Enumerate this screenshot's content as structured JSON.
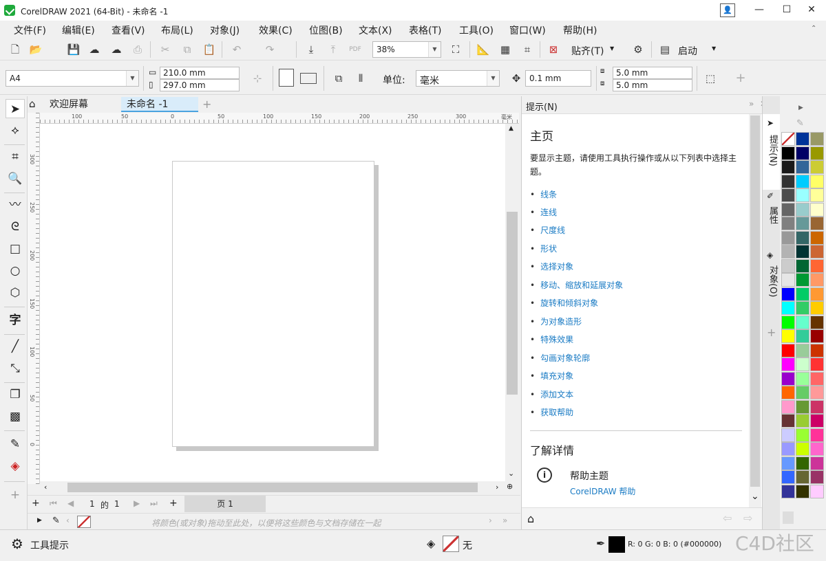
{
  "window": {
    "title": "CorelDRAW 2021 (64-Bit) - 未命名 -1"
  },
  "menu": [
    "文件(F)",
    "编辑(E)",
    "查看(V)",
    "布局(L)",
    "对象(J)",
    "效果(C)",
    "位图(B)",
    "文本(X)",
    "表格(T)",
    "工具(O)",
    "窗口(W)",
    "帮助(H)"
  ],
  "toolbar": {
    "zoom": "38%",
    "snap_label": "贴齐(T)",
    "launch_label": "启动"
  },
  "property_bar": {
    "page_size": "A4",
    "width": "210.0 mm",
    "height": "297.0 mm",
    "unit_label": "单位:",
    "unit_value": "毫米",
    "nudge": "0.1 mm",
    "dup_x": "5.0 mm",
    "dup_y": "5.0 mm"
  },
  "tabs": {
    "home": "欢迎屏幕",
    "doc": "未命名 -1"
  },
  "ruler_h": [
    "100",
    "50",
    "0",
    "50",
    "100",
    "150",
    "200",
    "250",
    "300",
    "毫米"
  ],
  "ruler_v": [
    "300",
    "250",
    "200",
    "150",
    "100",
    "50",
    "0"
  ],
  "pagenav": {
    "current": "1",
    "of": "的",
    "total": "1",
    "page_tab": "页 1"
  },
  "doc_palette": {
    "hint": "将颜色(或对象)拖动至此处，以便将这些颜色与文档存储在一起"
  },
  "hints": {
    "header": "提示(N)",
    "title": "主页",
    "desc": "要显示主题，请使用工具执行操作或从以下列表中选择主题。",
    "topics": [
      "线条",
      "连线",
      "尺度线",
      "形状",
      "选择对象",
      "移动、缩放和延展对象",
      "旋转和倾斜对象",
      "为对象造形",
      "特殊效果",
      "勾画对象轮廓",
      "填充对象",
      "添加文本",
      "获取帮助"
    ],
    "more_title": "了解详情",
    "help_topic": "帮助主题",
    "help_link": "CorelDRAW 帮助"
  },
  "side_tabs": [
    "提示(N)",
    "属性",
    "对象(O)"
  ],
  "palette": {
    "col1": [
      "#ffffff",
      "#000000",
      "#1a1a1a",
      "#333333",
      "#4d4d4d",
      "#666666",
      "#808080",
      "#999999",
      "#b3b3b3",
      "#cccccc",
      "#e6e6e6",
      "#0000ff",
      "#00ffff",
      "#00ff00",
      "#ffff00",
      "#ff0000",
      "#ff00ff",
      "#9900cc",
      "#ff6600",
      "#ff99cc",
      "#663333",
      "#ccccff",
      "#9999ff",
      "#6699ff",
      "#3366ff",
      "#333399"
    ],
    "col2": [
      "#003399",
      "#000066",
      "#336699",
      "#00ccff",
      "#99ffff",
      "#99cccc",
      "#669999",
      "#336666",
      "#003333",
      "#006633",
      "#009933",
      "#00cc66",
      "#33cc66",
      "#66ffcc",
      "#33cc99",
      "#99cc99",
      "#ccffcc",
      "#99ff99",
      "#66cc66",
      "#669933",
      "#99cc33",
      "#99ff33",
      "#ccff00",
      "#336600",
      "#666633",
      "#333300"
    ],
    "col3": [
      "#999966",
      "#999900",
      "#cccc33",
      "#ffff66",
      "#ffff99",
      "#ffffcc",
      "#996633",
      "#cc6600",
      "#cc6633",
      "#ff6633",
      "#ff9966",
      "#ff9933",
      "#ffcc00",
      "#663300",
      "#990000",
      "#cc3300",
      "#ff3333",
      "#ff6666",
      "#ff9999",
      "#cc3366",
      "#cc0066",
      "#ff3399",
      "#ff66cc",
      "#cc3399",
      "#993366",
      "#ffccff"
    ]
  },
  "status": {
    "left": "工具提示",
    "fill_none": "无",
    "color_readout": "R: 0 G: 0 B: 0 (#000000)",
    "watermark": "C4D社区"
  }
}
